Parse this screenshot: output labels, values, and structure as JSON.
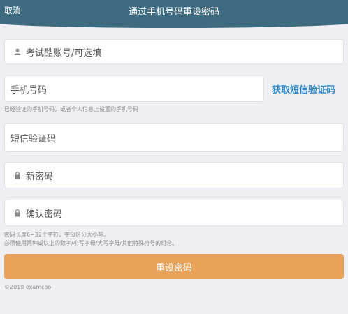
{
  "header": {
    "cancel_label": "取消",
    "title": "通过手机号码重设密码"
  },
  "form": {
    "account_placeholder": "考试酷账号/可选填",
    "phone_placeholder": "手机号码",
    "get_code_label": "获取短信验证码",
    "phone_hint": "已经验证的手机号码，或者个人信息上设置的手机号码",
    "code_placeholder": "短信验证码",
    "new_password_placeholder": "新密码",
    "confirm_password_placeholder": "确认密码",
    "password_rules": [
      "密码长度6~32个字符，字母区分大小写。",
      "必须使用两种或以上的数字/小写字母/大写字母/其他特殊符号的组合。"
    ],
    "submit_label": "重设密码"
  },
  "footer": {
    "copyright": "©2019 examcoo"
  },
  "colors": {
    "header": "#3e6b80",
    "link": "#2f86c8",
    "button": "#e8a25a"
  }
}
